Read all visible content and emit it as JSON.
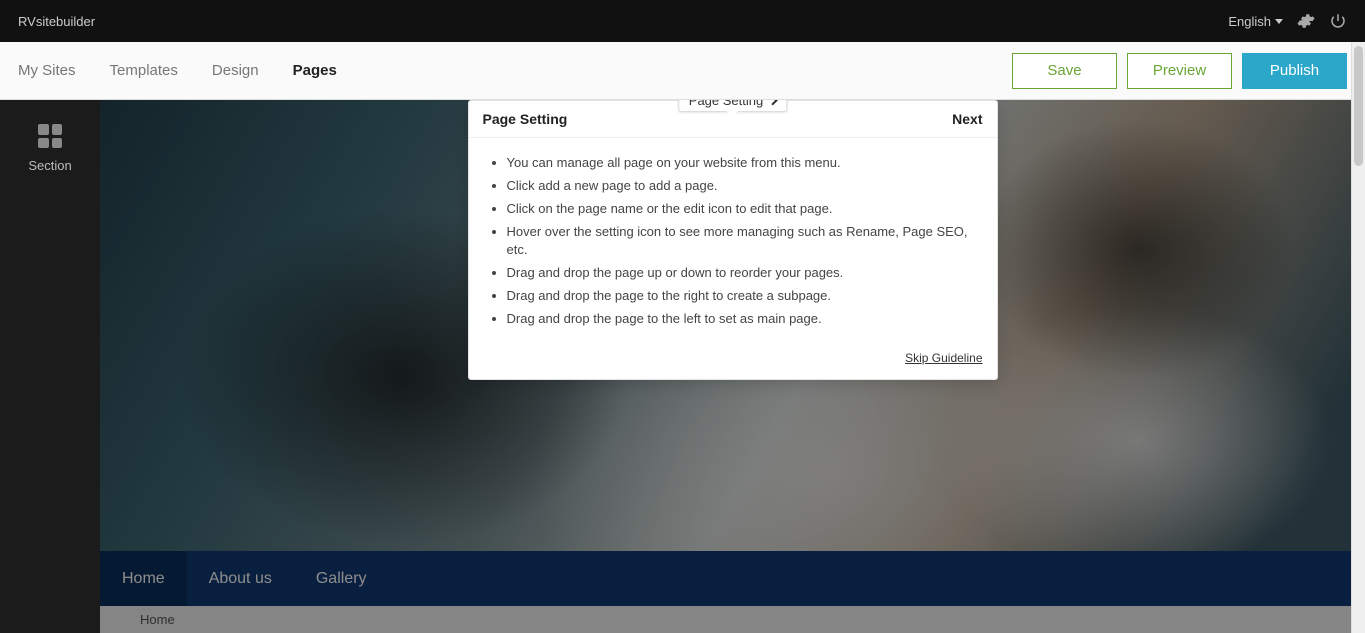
{
  "topbar": {
    "brand": "RVsitebuilder",
    "language_label": "English"
  },
  "subnav": {
    "tabs": [
      {
        "label": "My Sites",
        "active": false
      },
      {
        "label": "Templates",
        "active": false
      },
      {
        "label": "Design",
        "active": false
      },
      {
        "label": "Pages",
        "active": true
      }
    ],
    "page_setting_badge": "Page Setting",
    "actions": {
      "save": "Save",
      "preview": "Preview",
      "publish": "Publish"
    }
  },
  "sidebar": {
    "section_label": "Section"
  },
  "popover": {
    "title": "Page Setting",
    "next_label": "Next",
    "bullets": [
      "You can manage all page on your website from this menu.",
      "Click add a new page to add a page.",
      "Click on the page name or the edit icon to edit that page.",
      "Hover over the setting icon to see more managing such as Rename, Page SEO, etc.",
      "Drag and drop the page up or down to reorder your pages.",
      "Drag and drop the page to the right to create a subpage.",
      "Drag and drop the page to the left to set as main page."
    ],
    "skip_label": "Skip Guideline"
  },
  "sitenav": {
    "items": [
      {
        "label": "Home",
        "active": true
      },
      {
        "label": "About us",
        "active": false
      },
      {
        "label": "Gallery",
        "active": false
      }
    ]
  },
  "breadcrumb": {
    "current": "Home"
  }
}
